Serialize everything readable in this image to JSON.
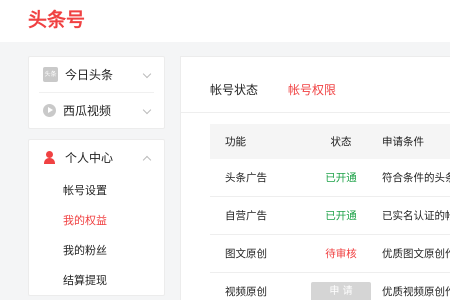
{
  "header": {
    "logo": "头条号"
  },
  "sidebar": {
    "top_items": [
      {
        "label": "今日头条",
        "icon": "toutiao-icon",
        "icon_text": "头条"
      },
      {
        "label": "西瓜视频",
        "icon": "xigua-video-icon"
      }
    ],
    "personal": {
      "label": "个人中心",
      "icon": "user-icon",
      "items": [
        {
          "label": "帐号设置"
        },
        {
          "label": "我的权益",
          "active": true
        },
        {
          "label": "我的粉丝"
        },
        {
          "label": "结算提现"
        }
      ]
    }
  },
  "tabs": [
    {
      "label": "帐号状态"
    },
    {
      "label": "帐号权限",
      "active": true
    }
  ],
  "table": {
    "headers": [
      "功能",
      "状态",
      "申请条件"
    ],
    "rows": [
      {
        "feature": "头条广告",
        "status": "已开通",
        "condition": "符合条件的头条"
      },
      {
        "feature": "自营广告",
        "status": "已开通",
        "condition": "已实名认证的帐"
      },
      {
        "feature": "图文原创",
        "status": "待审核",
        "condition": "优质图文原创作"
      },
      {
        "feature": "视频原创",
        "status": "申 请",
        "condition": "优质视频原创作"
      }
    ]
  },
  "colors": {
    "brand": "#f04142",
    "success": "#20a34a",
    "disabled_button": "#d5d5d5"
  }
}
